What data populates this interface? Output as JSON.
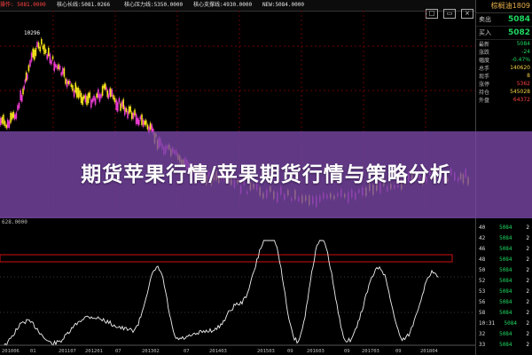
{
  "header": {
    "indicators": [
      {
        "text": "操作: 5081.0000",
        "color": "#ff4040"
      },
      {
        "text": "核心长线:5081.0266",
        "color": "#e6e6e6"
      },
      {
        "text": "核心压力线:5350.0000",
        "color": "#e6e6e6"
      },
      {
        "text": "核心支撑线:4930.0000",
        "color": "#e6e6e6"
      },
      {
        "text": "NEW:5084.0000",
        "color": "#e6e6e6"
      }
    ],
    "window_buttons": [
      "□",
      "▭",
      "×"
    ]
  },
  "price_chart": {
    "peak_label": "10296",
    "grid_color": "#6b0000"
  },
  "lower_chart": {
    "scale_label": "628.0000",
    "x_labels": [
      "201006",
      "01",
      "201107",
      "201201",
      "07",
      "201302",
      "07",
      "201403",
      "201503",
      "09",
      "201603",
      "09",
      "201703",
      "09",
      "201804"
    ]
  },
  "panel": {
    "title": "棕榈油1809",
    "sell": {
      "label": "卖出",
      "value": "5084"
    },
    "buy": {
      "label": "买入",
      "value": "5082"
    },
    "stats": [
      {
        "label": "最新",
        "value": "5084",
        "color": "#1ed760"
      },
      {
        "label": "涨跌",
        "value": "-24",
        "color": "#1ed760"
      },
      {
        "label": "幅度",
        "value": "-0.47%",
        "color": "#1ed760"
      },
      {
        "label": "总手",
        "value": "140620",
        "color": "#f5d442"
      },
      {
        "label": "现手",
        "value": "8",
        "color": "#f5d442"
      },
      {
        "label": "涨停",
        "value": "5362",
        "color": "#ff4040"
      },
      {
        "label": "持仓",
        "value": "545028",
        "color": "#f5d442"
      },
      {
        "label": "外盘",
        "value": "64372",
        "color": "#ff4040"
      }
    ],
    "ticks": [
      {
        "t": "40",
        "p": "5084",
        "c": "2"
      },
      {
        "t": "42",
        "p": "5084",
        "c": "2"
      },
      {
        "t": "46",
        "p": "5084",
        "c": "2"
      },
      {
        "t": "48",
        "p": "5084",
        "c": "2"
      },
      {
        "t": "50",
        "p": "5084",
        "c": "2"
      },
      {
        "t": "52",
        "p": "5084",
        "c": "2"
      },
      {
        "t": "53",
        "p": "5084",
        "c": "2"
      },
      {
        "t": "56",
        "p": "5084",
        "c": "2"
      },
      {
        "t": "58",
        "p": "5084",
        "c": "2"
      },
      {
        "t": "10:31",
        "p": "5084",
        "c": "2"
      },
      {
        "t": "32",
        "p": "5084",
        "c": "2"
      },
      {
        "t": "33",
        "p": "5084",
        "c": "2"
      }
    ]
  },
  "banner": {
    "title": "期货苹果行情/苹果期货行情与策略分析"
  }
}
